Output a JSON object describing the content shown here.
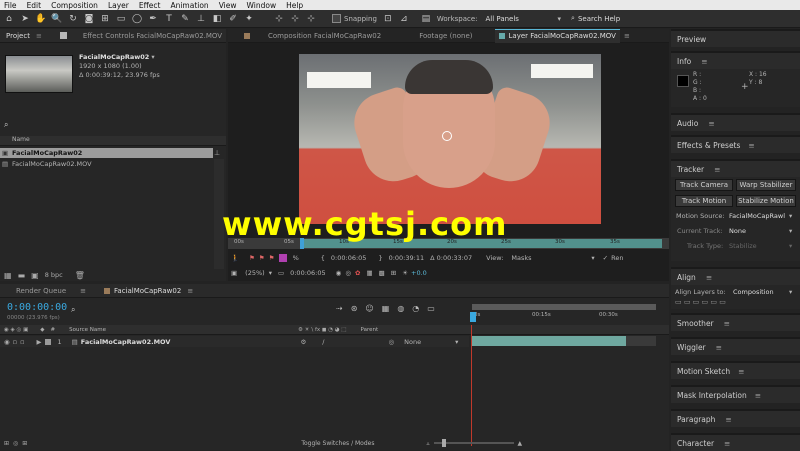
{
  "menu": [
    "File",
    "Edit",
    "Composition",
    "Layer",
    "Effect",
    "Animation",
    "View",
    "Window",
    "Help"
  ],
  "toolbar": {
    "snapping": "Snapping",
    "workspace_label": "Workspace:",
    "workspace_value": "All Panels",
    "search_placeholder": "Search Help"
  },
  "project": {
    "tab": "Project",
    "effect_controls_tab": "Effect Controls FacialMoCapRaw02.MOV",
    "item_name": "FacialMoCapRaw02",
    "item_dims": "1920 x 1080 (1.00)",
    "item_duration": "Δ 0:00:39:12, 23.976 fps",
    "col_name": "Name",
    "items": [
      "FacialMoCapRaw02",
      "FacialMoCapRaw02.MOV"
    ],
    "bpc": "8 bpc"
  },
  "viewer": {
    "tabs": [
      "Composition FacialMoCapRaw02",
      "Footage (none)",
      "Layer FacialMoCapRaw02.MOV"
    ],
    "ruler": [
      "00s",
      "05s",
      "10s",
      "15s",
      "20s",
      "25s",
      "30s",
      "35s"
    ],
    "tc_in": "0:00:06:05",
    "tc_out": "0:00:39:11",
    "tc_dur": "Δ 0:00:33:07",
    "view_label": "View:",
    "view_value": "Masks",
    "render_label": "Ren",
    "zoom": "(25%)",
    "current_time": "0:00:06:05",
    "exposure": "+0.0",
    "pct": "%"
  },
  "watermark": "www.cgtsj.com",
  "timeline": {
    "tabs": [
      "Render Queue",
      "FacialMoCapRaw02"
    ],
    "timecode": "0:00:00:00",
    "frames": "00000 (23.976 fps)",
    "col_source": "Source Name",
    "col_parent": "Parent",
    "layer_num": "1",
    "layer_name": "FacialMoCapRaw02.MOV",
    "parent_value": "None",
    "ruler": [
      "0s",
      "00:15s",
      "00:30s"
    ],
    "toggle": "Toggle Switches / Modes"
  },
  "right": {
    "preview": "Preview",
    "info": "Info",
    "info_r": "R :",
    "info_g": "G :",
    "info_b": "B :",
    "info_a": "A : 0",
    "info_x": "X : 16",
    "info_y": "Y : 8",
    "audio": "Audio",
    "effects": "Effects & Presets",
    "tracker": "Tracker",
    "track_camera": "Track Camera",
    "warp_stabilizer": "Warp Stabilizer",
    "track_motion": "Track Motion",
    "stabilize_motion": "Stabilize Motion",
    "motion_source_label": "Motion Source:",
    "motion_source_value": "FacialMoCapRawl",
    "current_track_label": "Current Track:",
    "current_track_value": "None",
    "track_type_label": "Track Type:",
    "track_type_value": "Stabilize",
    "align": "Align",
    "align_to_label": "Align Layers to:",
    "align_to_value": "Composition",
    "smoother": "Smoother",
    "wiggler": "Wiggler",
    "motion_sketch": "Motion Sketch",
    "mask_interp": "Mask Interpolation",
    "paragraph": "Paragraph",
    "character": "Character"
  }
}
